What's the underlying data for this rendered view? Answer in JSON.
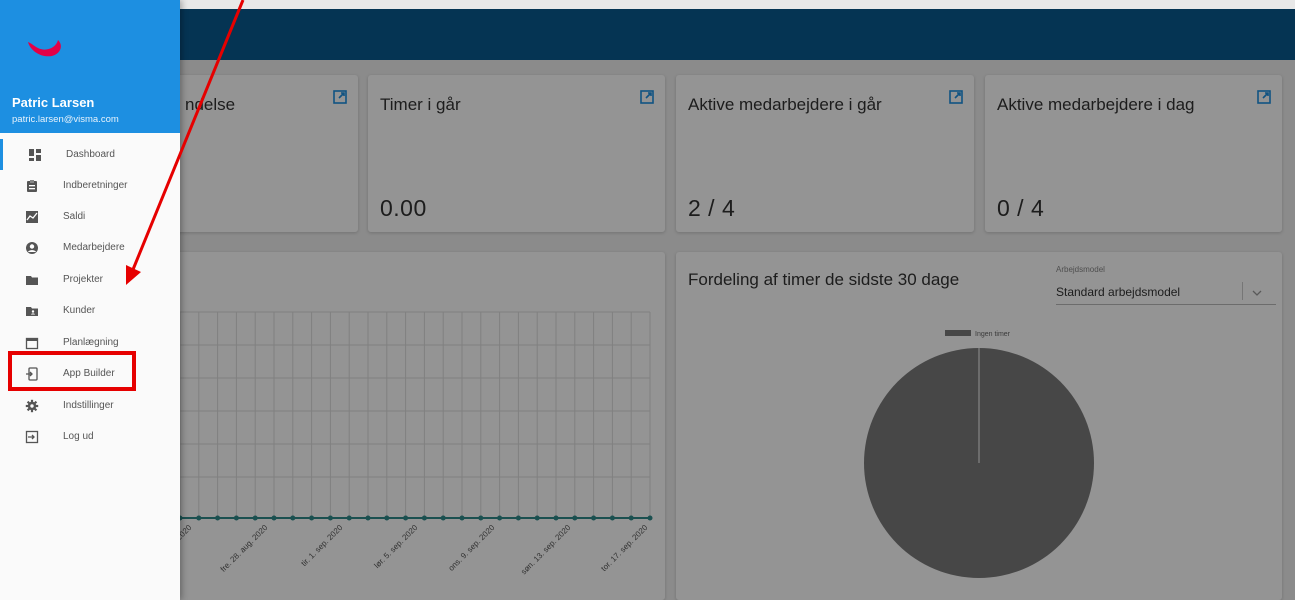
{
  "user": {
    "name": "Patric Larsen",
    "email": "patric.larsen@visma.com"
  },
  "nav": [
    {
      "label": "Dashboard",
      "icon": "dashboard-icon"
    },
    {
      "label": "Indberetninger",
      "icon": "clipboard-icon"
    },
    {
      "label": "Saldi",
      "icon": "trend-icon"
    },
    {
      "label": "Medarbejdere",
      "icon": "account-icon"
    },
    {
      "label": "Projekter",
      "icon": "folder-icon"
    },
    {
      "label": "Kunder",
      "icon": "folder-account-icon"
    },
    {
      "label": "Planlægning",
      "icon": "calendar-icon"
    },
    {
      "label": "App Builder",
      "icon": "app-builder-icon"
    },
    {
      "label": "Indstillinger",
      "icon": "gear-icon"
    },
    {
      "label": "Log ud",
      "icon": "logout-icon"
    }
  ],
  "cards": [
    {
      "title": "ndelse",
      "value": ""
    },
    {
      "title": "Timer i går",
      "value": "0.00"
    },
    {
      "title": "Aktive medarbejdere i går",
      "value": "2 / 4"
    },
    {
      "title": "Aktive medarbejdere i dag",
      "value": "0 / 4"
    }
  ],
  "line_chart": {
    "x_labels": [
      "2020",
      "fre. 28. aug. 2020",
      "tir. 1. sep. 2020",
      "lør. 5. sep. 2020",
      "ons. 9. sep. 2020",
      "søn. 13. sep. 2020",
      "tor. 17. sep. 2020"
    ]
  },
  "pie_card": {
    "title": "Fordeling af timer de sidste 30 dage",
    "select_label": "Arbejdsmodel",
    "select_value": "Standard arbejdsmodel",
    "legend": "Ingen timer"
  },
  "colors": {
    "brand": "#1d8fe1",
    "topbar": "#0a5a8f",
    "highlight": "#e60000",
    "pie": "#7a7a7a"
  }
}
